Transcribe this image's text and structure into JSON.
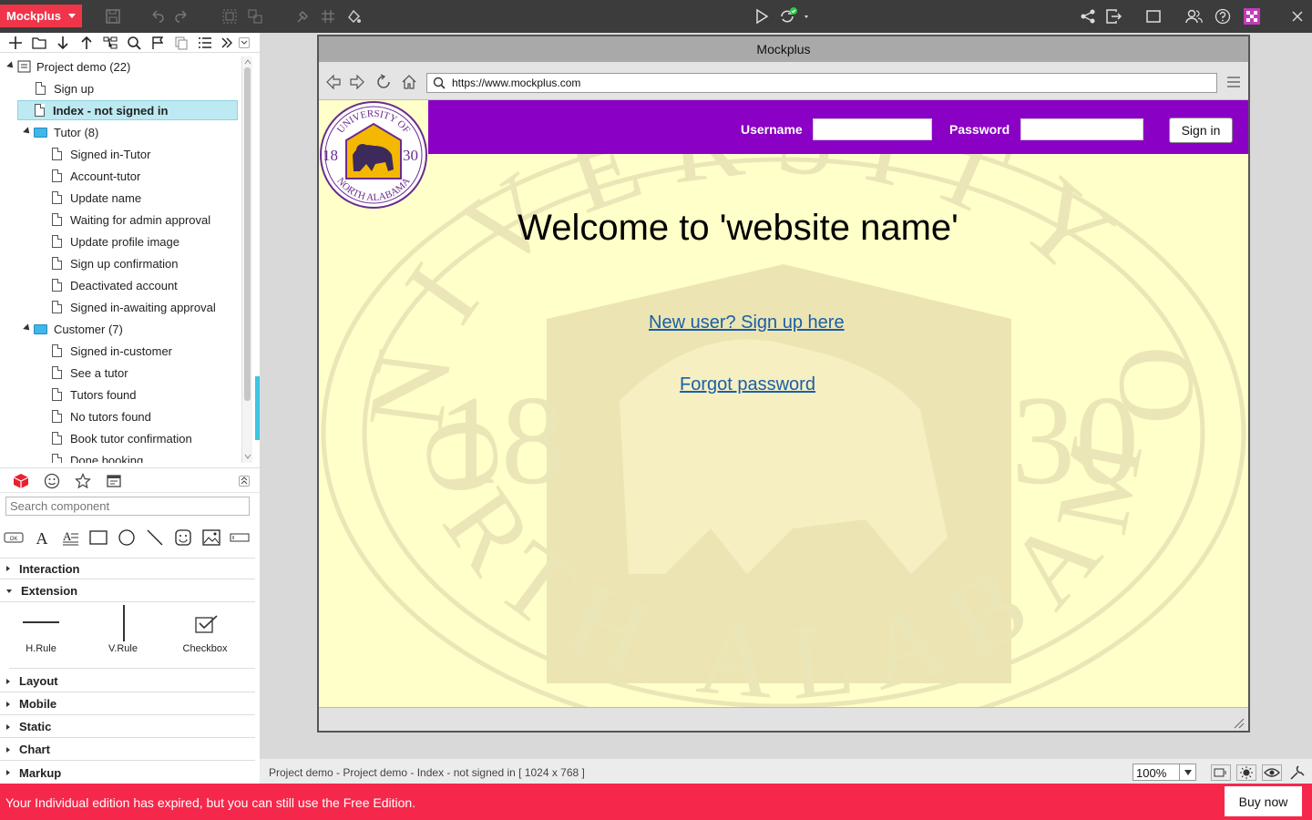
{
  "app": {
    "brand": "Mockplus"
  },
  "tree": {
    "items": [
      {
        "label": "Project demo (22)",
        "kind": "project"
      },
      {
        "label": "Sign up",
        "kind": "page"
      },
      {
        "label": "Index - not signed in",
        "kind": "page",
        "selected": true
      },
      {
        "label": "Tutor (8)",
        "kind": "folder"
      },
      {
        "label": "Signed in-Tutor",
        "kind": "page"
      },
      {
        "label": "Account-tutor",
        "kind": "page"
      },
      {
        "label": "Update name",
        "kind": "page"
      },
      {
        "label": "Waiting for admin approval",
        "kind": "page"
      },
      {
        "label": "Update profile image",
        "kind": "page"
      },
      {
        "label": "Sign up confirmation",
        "kind": "page"
      },
      {
        "label": "Deactivated account",
        "kind": "page"
      },
      {
        "label": "Signed in-awaiting approval",
        "kind": "page"
      },
      {
        "label": "Customer (7)",
        "kind": "folder"
      },
      {
        "label": "Signed in-customer",
        "kind": "page"
      },
      {
        "label": "See a tutor",
        "kind": "page"
      },
      {
        "label": "Tutors found",
        "kind": "page"
      },
      {
        "label": "No tutors found",
        "kind": "page"
      },
      {
        "label": "Book tutor confirmation",
        "kind": "page"
      },
      {
        "label": "Done booking",
        "kind": "page"
      }
    ]
  },
  "components": {
    "search_placeholder": "Search component",
    "shape_ok_label": "OK",
    "sections": {
      "interaction": "Interaction",
      "extension": "Extension",
      "layout": "Layout",
      "mobile": "Mobile",
      "static": "Static",
      "chart": "Chart",
      "markup": "Markup"
    },
    "extension_items": {
      "hrule": "H.Rule",
      "vrule": "V.Rule",
      "checkbox": "Checkbox"
    }
  },
  "frame": {
    "title": "Mockplus",
    "url": "https://www.mockplus.com"
  },
  "page": {
    "username_label": "Username",
    "password_label": "Password",
    "signin_label": "Sign in",
    "welcome": "Welcome to 'website name'",
    "new_user_link": "New user? Sign up here",
    "forgot_link": "Forgot password",
    "seal": {
      "top": "UNIVERSITY OF",
      "bottom": "NORTH ALABAMA",
      "year_left": "18",
      "year_right": "30"
    }
  },
  "status": {
    "path": "Project demo - Project demo - Index - not signed in [ 1024 x 768 ]",
    "zoom": "100%"
  },
  "banner": {
    "message": "Your Individual edition has expired, but you can still use the Free Edition.",
    "buy_label": "Buy now"
  },
  "colors": {
    "brand": "#f0354b",
    "banner": "#f5284c",
    "header_purple": "#8a00c4",
    "page_bg": "#ffffc9",
    "link": "#1a5fa8",
    "selection": "#bdeaf2"
  }
}
